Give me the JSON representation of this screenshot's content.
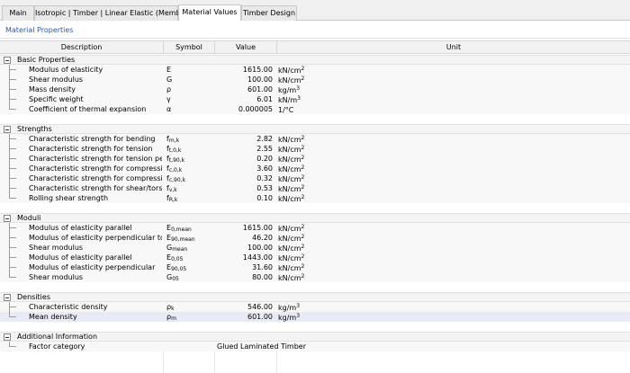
{
  "tabs": [
    {
      "label": "Main",
      "active": false
    },
    {
      "label": "Isotropic | Timber | Linear Elastic (Members)",
      "active": false
    },
    {
      "label": "Material Values",
      "active": true
    },
    {
      "label": "Timber Design",
      "active": false
    }
  ],
  "section": {
    "title": "Material Properties"
  },
  "columns": {
    "description": "Description",
    "symbol": "Symbol",
    "value": "Value",
    "unit": "Unit"
  },
  "groups": [
    {
      "name": "Basic Properties",
      "rows": [
        {
          "desc": "Modulus of elasticity",
          "sym": "E",
          "sub": "",
          "value": "1615.00",
          "unit": "kN/cm",
          "sup": "2"
        },
        {
          "desc": "Shear modulus",
          "sym": "G",
          "sub": "",
          "value": "100.00",
          "unit": "kN/cm",
          "sup": "2"
        },
        {
          "desc": "Mass density",
          "sym": "ρ",
          "sub": "",
          "value": "601.00",
          "unit": "kg/m",
          "sup": "3"
        },
        {
          "desc": "Specific weight",
          "sym": "γ",
          "sub": "",
          "value": "6.01",
          "unit": "kN/m",
          "sup": "3"
        },
        {
          "desc": "Coefficient of thermal expansion",
          "sym": "α",
          "sub": "",
          "value": "0.000005",
          "unit": "1/°C",
          "sup": ""
        }
      ]
    },
    {
      "name": "Strengths",
      "rows": [
        {
          "desc": "Characteristic strength for bending",
          "sym": "f",
          "sub": "m,k",
          "value": "2.82",
          "unit": "kN/cm",
          "sup": "2"
        },
        {
          "desc": "Characteristic strength for tension",
          "sym": "f",
          "sub": "t,0,k",
          "value": "2.55",
          "unit": "kN/cm",
          "sup": "2"
        },
        {
          "desc": "Characteristic strength for tension perp...",
          "sym": "f",
          "sub": "t,90,k",
          "value": "0.20",
          "unit": "kN/cm",
          "sup": "2"
        },
        {
          "desc": "Characteristic strength for compression",
          "sym": "f",
          "sub": "c,0,k",
          "value": "3.60",
          "unit": "kN/cm",
          "sup": "2"
        },
        {
          "desc": "Characteristic strength for compression...",
          "sym": "f",
          "sub": "c,90,k",
          "value": "0.32",
          "unit": "kN/cm",
          "sup": "2"
        },
        {
          "desc": "Characteristic strength for shear/torsion",
          "sym": "f",
          "sub": "v,k",
          "value": "0.53",
          "unit": "kN/cm",
          "sup": "2"
        },
        {
          "desc": "Rolling shear strength",
          "sym": "f",
          "sub": "R,k",
          "value": "0.10",
          "unit": "kN/cm",
          "sup": "2"
        }
      ]
    },
    {
      "name": "Moduli",
      "rows": [
        {
          "desc": "Modulus of elasticity parallel",
          "sym": "E",
          "sub": "0,mean",
          "value": "1615.00",
          "unit": "kN/cm",
          "sup": "2"
        },
        {
          "desc": "Modulus of elasticity perpendicular to ...",
          "sym": "E",
          "sub": "90,mean",
          "value": "46.20",
          "unit": "kN/cm",
          "sup": "2"
        },
        {
          "desc": "Shear modulus",
          "sym": "G",
          "sub": "mean",
          "value": "100.00",
          "unit": "kN/cm",
          "sup": "2"
        },
        {
          "desc": "Modulus of elasticity parallel",
          "sym": "E",
          "sub": "0,05",
          "value": "1443.00",
          "unit": "kN/cm",
          "sup": "2"
        },
        {
          "desc": "Modulus of elasticity perpendicular",
          "sym": "E",
          "sub": "90,05",
          "value": "31.60",
          "unit": "kN/cm",
          "sup": "2"
        },
        {
          "desc": "Shear modulus",
          "sym": "G",
          "sub": "05",
          "value": "80.00",
          "unit": "kN/cm",
          "sup": "2"
        }
      ]
    },
    {
      "name": "Densities",
      "rows": [
        {
          "desc": "Characteristic density",
          "sym": "ρ",
          "sub": "k",
          "value": "546.00",
          "unit": "kg/m",
          "sup": "3"
        },
        {
          "desc": "Mean density",
          "sym": "ρ",
          "sub": "m",
          "value": "601.00",
          "unit": "kg/m",
          "sup": "3",
          "highlight": true
        }
      ]
    },
    {
      "name": "Additional Information",
      "rows": [
        {
          "desc": "Factor category",
          "sym": "",
          "sub": "",
          "value": "Glued Laminated Timber",
          "unit": "",
          "sup": "",
          "text": true
        }
      ]
    }
  ]
}
